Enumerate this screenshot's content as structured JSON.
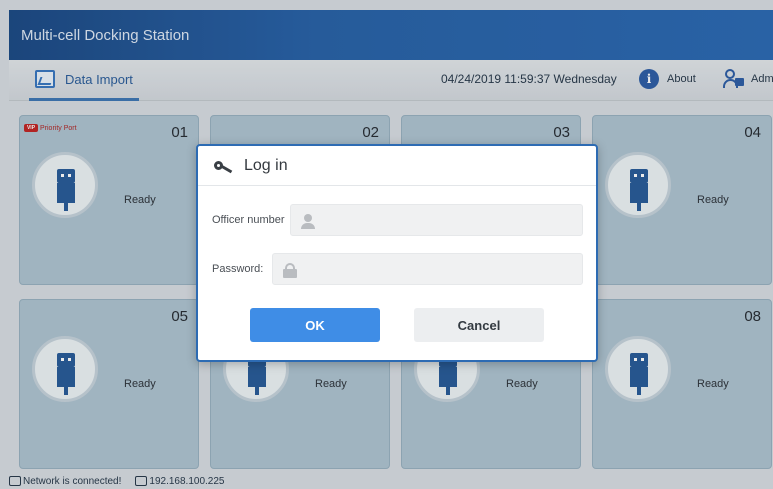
{
  "app": {
    "title": "Multi-cell Docking Station"
  },
  "toolbar": {
    "tab_label": "Data Import",
    "datetime": "04/24/2019 11:59:37 Wednesday",
    "about_label": "About",
    "admin_label": "Admin"
  },
  "cells": [
    {
      "number": "01",
      "status": "Ready",
      "badge": "Priority Port"
    },
    {
      "number": "02",
      "status": ""
    },
    {
      "number": "03",
      "status": ""
    },
    {
      "number": "04",
      "status": "Ready"
    },
    {
      "number": "05",
      "status": "Ready"
    },
    {
      "number": "",
      "status": "Ready"
    },
    {
      "number": "",
      "status": "Ready"
    },
    {
      "number": "08",
      "status": "Ready"
    }
  ],
  "statusbar": {
    "network": "Network is connected!",
    "ip": "192.168.100.225"
  },
  "dialog": {
    "title": "Log in",
    "officer_label": "Officer number",
    "officer_value": "",
    "password_label": "Password:",
    "password_value": "",
    "ok_label": "OK",
    "cancel_label": "Cancel"
  }
}
